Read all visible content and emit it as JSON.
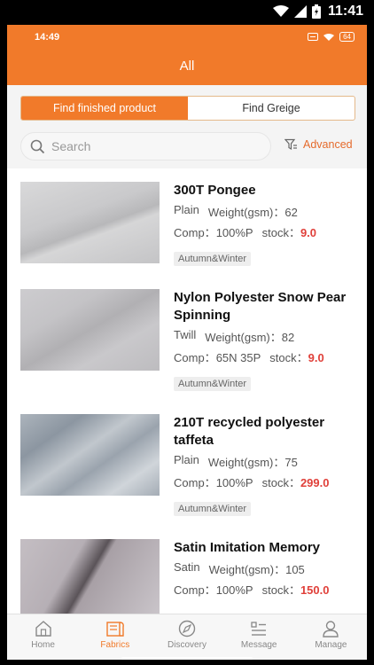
{
  "system": {
    "time": "11:41"
  },
  "inner_status": {
    "time": "14:49",
    "battery": "64"
  },
  "header": {
    "title": "All"
  },
  "segmented": {
    "active_label": "Find finished product",
    "inactive_label": "Find Greige"
  },
  "search": {
    "placeholder": "Search",
    "advanced_label": "Advanced"
  },
  "products": [
    {
      "name": "300T Pongee",
      "weave": "Plain",
      "weight_label": "Weight(gsm)：",
      "weight": "62",
      "comp_label": "Comp：",
      "comp": "100%P",
      "stock_label": "stock：",
      "stock": "9.0",
      "tag": "Autumn&Winter"
    },
    {
      "name": "Nylon Polyester Snow Pear Spinning",
      "weave": "Twill",
      "weight_label": "Weight(gsm)：",
      "weight": "82",
      "comp_label": "Comp：",
      "comp": "65N 35P",
      "stock_label": "stock：",
      "stock": "9.0",
      "tag": "Autumn&Winter"
    },
    {
      "name": "210T recycled polyester taffeta",
      "weave": "Plain",
      "weight_label": "Weight(gsm)：",
      "weight": "75",
      "comp_label": "Comp：",
      "comp": "100%P",
      "stock_label": "stock：",
      "stock": "299.0",
      "tag": "Autumn&Winter"
    },
    {
      "name": "Satin Imitation Memory",
      "weave": "Satin",
      "weight_label": "Weight(gsm)：",
      "weight": "105",
      "comp_label": "Comp：",
      "comp": "100%P",
      "stock_label": "stock：",
      "stock": "150.0",
      "tag": ""
    }
  ],
  "tabs": [
    {
      "label": "Home",
      "icon": "home-icon"
    },
    {
      "label": "Fabrics",
      "icon": "fabrics-icon",
      "active": true
    },
    {
      "label": "Discovery",
      "icon": "compass-icon"
    },
    {
      "label": "Message",
      "icon": "list-icon"
    },
    {
      "label": "Manage",
      "icon": "user-icon"
    }
  ],
  "colors": {
    "accent": "#f17a2a",
    "price": "#e0403a"
  }
}
